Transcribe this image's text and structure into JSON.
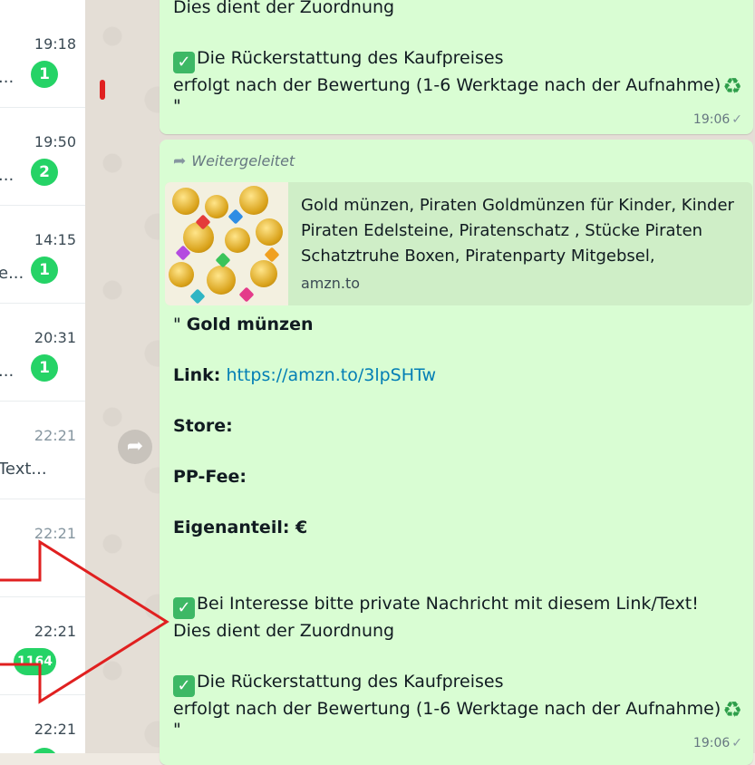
{
  "sidebar": {
    "chats": [
      {
        "time": "19:18",
        "snippet": "...",
        "badge": "1"
      },
      {
        "time": "19:50",
        "snippet": "...",
        "badge": "2"
      },
      {
        "time": "14:15",
        "snippet": "e...",
        "badge": "1"
      },
      {
        "time": "20:31",
        "snippet": "...",
        "badge": "1"
      },
      {
        "time": "22:21",
        "snippet": "Text...",
        "badge": ""
      },
      {
        "time": "22:21",
        "snippet": "",
        "badge": ""
      },
      {
        "time": "22:21",
        "snippet": "",
        "badge": "1164"
      },
      {
        "time": "22:21",
        "snippet": "",
        "badge": ""
      }
    ]
  },
  "message_top": {
    "line1": "Dies dient der Zuordnung",
    "line2": "Die Rückerstattung des Kaufpreises",
    "line3": "erfolgt nach der Bewertung (1-6 Werktage nach der Aufnahme)",
    "line4": "\"",
    "time": "19:06"
  },
  "message_main": {
    "forwarded_label": "Weitergeleitet",
    "preview": {
      "title": "Gold münzen, Piraten Goldmünzen für Kinder, Kinder Piraten Edelsteine, Piratenschatz , Stücke Piraten Schatztruhe Boxen, Piratenparty Mitgebsel,",
      "host": "amzn.to"
    },
    "product_prefix": "\" ",
    "product_name": "Gold münzen",
    "link_label": "Link:",
    "link_url": "https://amzn.to/3lpSHTw",
    "store_label": "Store:",
    "ppfee_label": "PP-Fee:",
    "eigenanteil_label": "Eigenanteil:  €",
    "interest_line": "Bei Interesse bitte  private  Nachricht  mit diesem Link/Text!",
    "assign_line": "Dies dient der Zuordnung",
    "refund_line1": "Die Rückerstattung des Kaufpreises",
    "refund_line2": "erfolgt nach der Bewertung (1-6 Werktage nach der Aufnahme)",
    "closing_quote": "\"",
    "time": "19:06"
  },
  "icons": {
    "forward": "forward-arrow-icon",
    "check": "single-check-icon",
    "checkmark_emoji": "white-check-mark-icon",
    "recycle_emoji": "recycle-icon"
  },
  "colors": {
    "bubble": "#d9fdd3",
    "unread_badge": "#25d366",
    "link": "#027eb5",
    "annotation_arrow": "#e02020"
  }
}
